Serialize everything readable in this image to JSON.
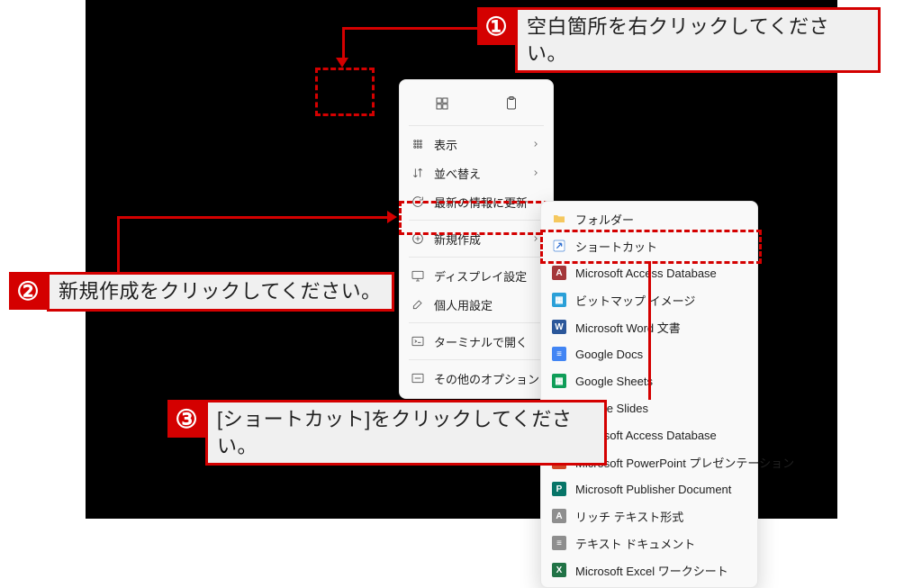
{
  "context_menu": {
    "view": "表示",
    "sort": "並べ替え",
    "refresh": "最新の情報に更新",
    "new": "新規作成",
    "display": "ディスプレイ設定",
    "personal": "個人用設定",
    "terminal": "ターミナルで開く",
    "more": "その他のオプションを確認"
  },
  "submenu": {
    "folder": "フォルダー",
    "shortcut": "ショートカット",
    "access": "Microsoft Access Database",
    "bmp": "ビットマップ イメージ",
    "word": "Microsoft Word 文書",
    "gdoc": "Google Docs",
    "gsheet": "Google Sheets",
    "gslide": "Google Slides",
    "access2": "Microsoft Access Database",
    "ppt": "Microsoft PowerPoint プレゼンテーション",
    "pub": "Microsoft Publisher Document",
    "rtf": "リッチ テキスト形式",
    "txt": "テキスト ドキュメント",
    "xls": "Microsoft Excel ワークシート"
  },
  "callouts": {
    "n1": "①",
    "t1": "空白箇所を右クリックしてください。",
    "n2": "②",
    "t2": "新規作成をクリックしてください。",
    "n3": "③",
    "t3": "[ショートカット]をクリックしてください。"
  }
}
